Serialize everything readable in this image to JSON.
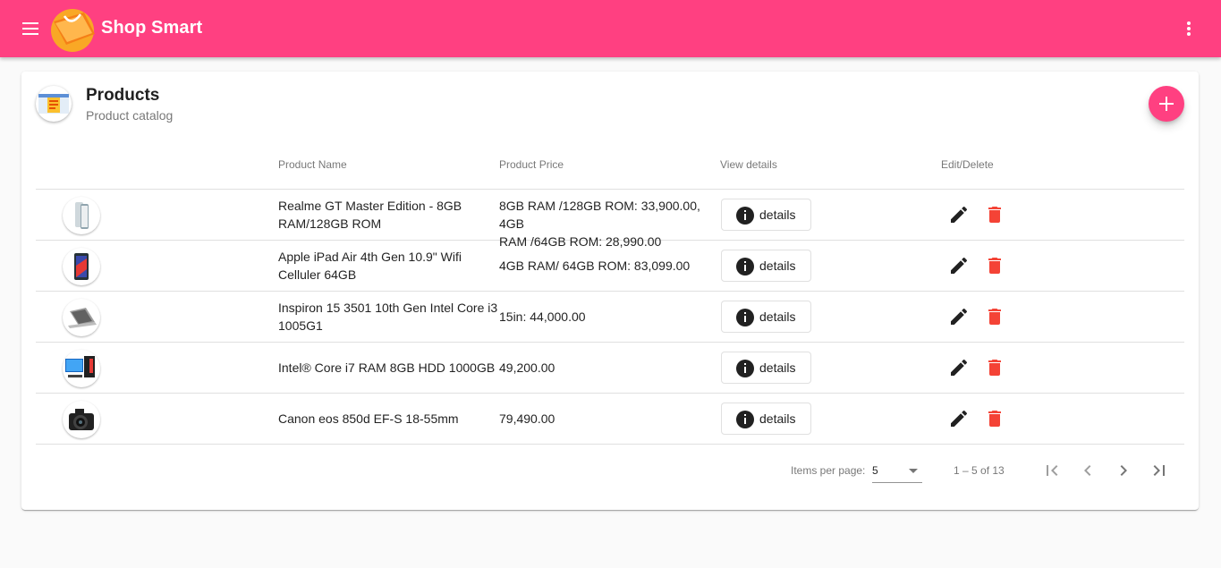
{
  "app": {
    "title": "Shop Smart"
  },
  "card": {
    "title": "Products",
    "subtitle": "Product catalog"
  },
  "table": {
    "headers": {
      "name": "Product Name",
      "price": "Product Price",
      "details": "View details",
      "actions": "Edit/Delete"
    },
    "details_label": "details",
    "rows": [
      {
        "name_lines": [
          "Realme GT Master Edition - 8GB",
          "RAM/128GB ROM"
        ],
        "price_lines": [
          "8GB RAM /128GB ROM: 33,900.00, 4GB",
          "RAM /64GB ROM: 28,990.00"
        ],
        "thumb": "phone"
      },
      {
        "name_lines": [
          "Apple iPad Air 4th Gen 10.9\" Wifi",
          "Celluler 64GB"
        ],
        "price_lines": [
          "4GB RAM/ 64GB ROM: 83,099.00"
        ],
        "thumb": "tablet"
      },
      {
        "name_lines": [
          "Inspiron 15 3501 10th Gen Intel Core i3",
          "1005G1"
        ],
        "price_lines": [
          "15in: 44,000.00"
        ],
        "thumb": "laptop"
      },
      {
        "name_lines": [
          "Intel® Core i7 RAM 8GB HDD 1000GB"
        ],
        "price_lines": [
          "49,200.00"
        ],
        "thumb": "desktop"
      },
      {
        "name_lines": [
          "Canon eos 850d EF-S 18-55mm"
        ],
        "price_lines": [
          "79,490.00"
        ],
        "thumb": "camera"
      }
    ]
  },
  "paginator": {
    "items_per_page_label": "Items per page:",
    "page_size": "5",
    "range": "1 – 5 of 13"
  },
  "colors": {
    "primary": "#ff4081",
    "delete": "#f44336",
    "icon": "#212121"
  }
}
